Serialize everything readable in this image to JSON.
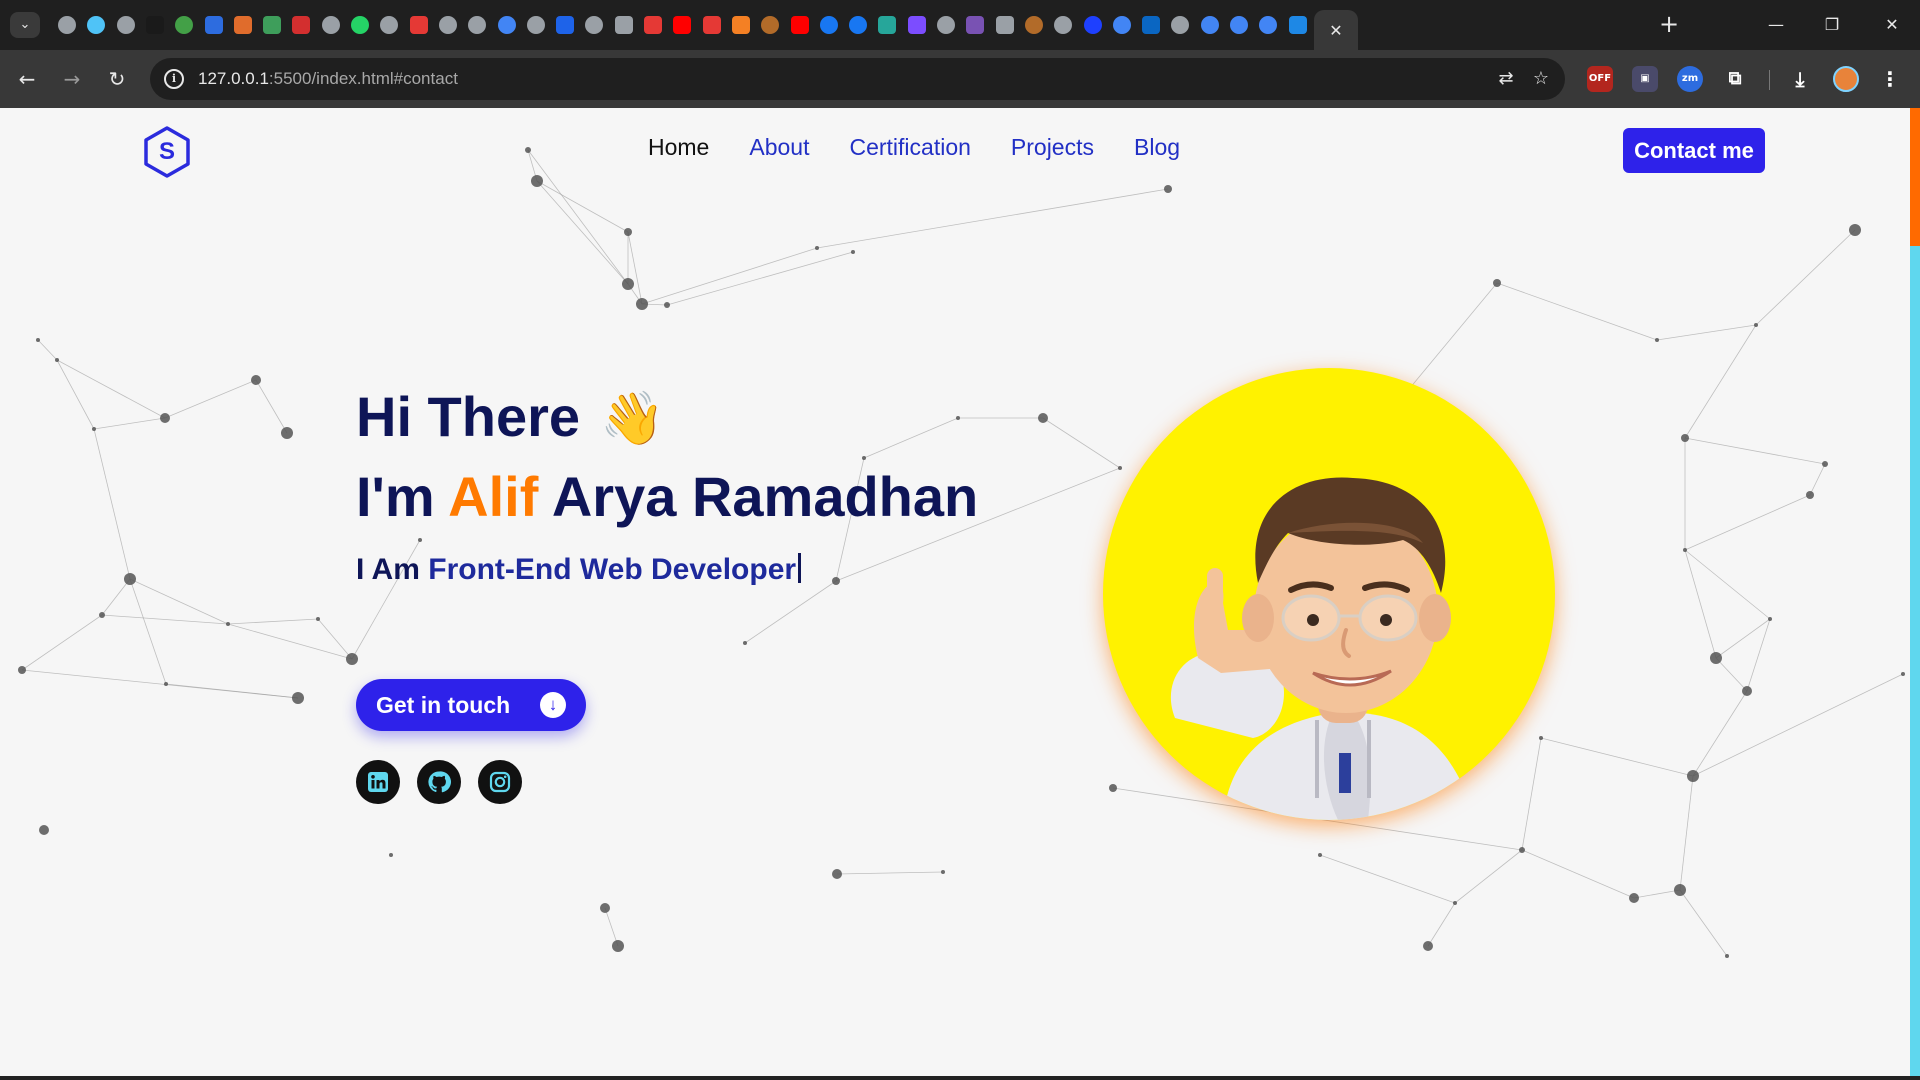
{
  "browser": {
    "url_host": "127.0.0.1",
    "url_rest": ":5500/index.html#contact",
    "tab_icons": [
      "chrome-icon",
      "analytics-icon",
      "chrome-icon",
      "notion-icon",
      "nodejs-icon",
      "jira-icon",
      "pen-icon",
      "shield-icon",
      "h-icon",
      "chrome-icon",
      "whatsapp-icon",
      "chrome-icon",
      "zoho-icon",
      "github-copilot-icon",
      "chrome-icon",
      "google-icon",
      "chrome-icon",
      "flag-icon",
      "chrome-icon",
      "copilot-icon",
      "laravel-icon",
      "youtube-icon",
      "laravel-icon",
      "stackoverflow-icon",
      "eye-icon",
      "youtube-icon",
      "facebook-icon",
      "facebook-icon",
      "d-icon",
      "figma-icon",
      "chrome-icon",
      "bootstrap-icon",
      "openai-icon",
      "eye-icon",
      "github-icon",
      "s-icon",
      "google-icon",
      "linkedin-icon",
      "github-icon",
      "google-icon",
      "google-icon",
      "google-icon",
      "heart-icon"
    ]
  },
  "nav": {
    "logo_letter": "S",
    "items": [
      {
        "label": "Home",
        "current": true
      },
      {
        "label": "About",
        "current": false
      },
      {
        "label": "Certification",
        "current": false
      },
      {
        "label": "Projects",
        "current": false
      },
      {
        "label": "Blog",
        "current": false
      }
    ],
    "contact_label": "Contact me"
  },
  "hero": {
    "greeting": "Hi There",
    "wave_emoji": "👋",
    "intro_prefix": "I'm",
    "first_name": "Alif",
    "last_name": "Arya Ramadhan",
    "role_prefix": "I Am",
    "role": "Front-End Web Developer",
    "cta_label": "Get in touch",
    "socials": [
      "linkedin-icon",
      "github-icon",
      "instagram-icon"
    ]
  },
  "colors": {
    "primary": "#2e22ea",
    "navy": "#0e1557",
    "accent": "#ff7a00",
    "avatar_bg": "#fff200",
    "social_icon": "#5fd7ee"
  }
}
